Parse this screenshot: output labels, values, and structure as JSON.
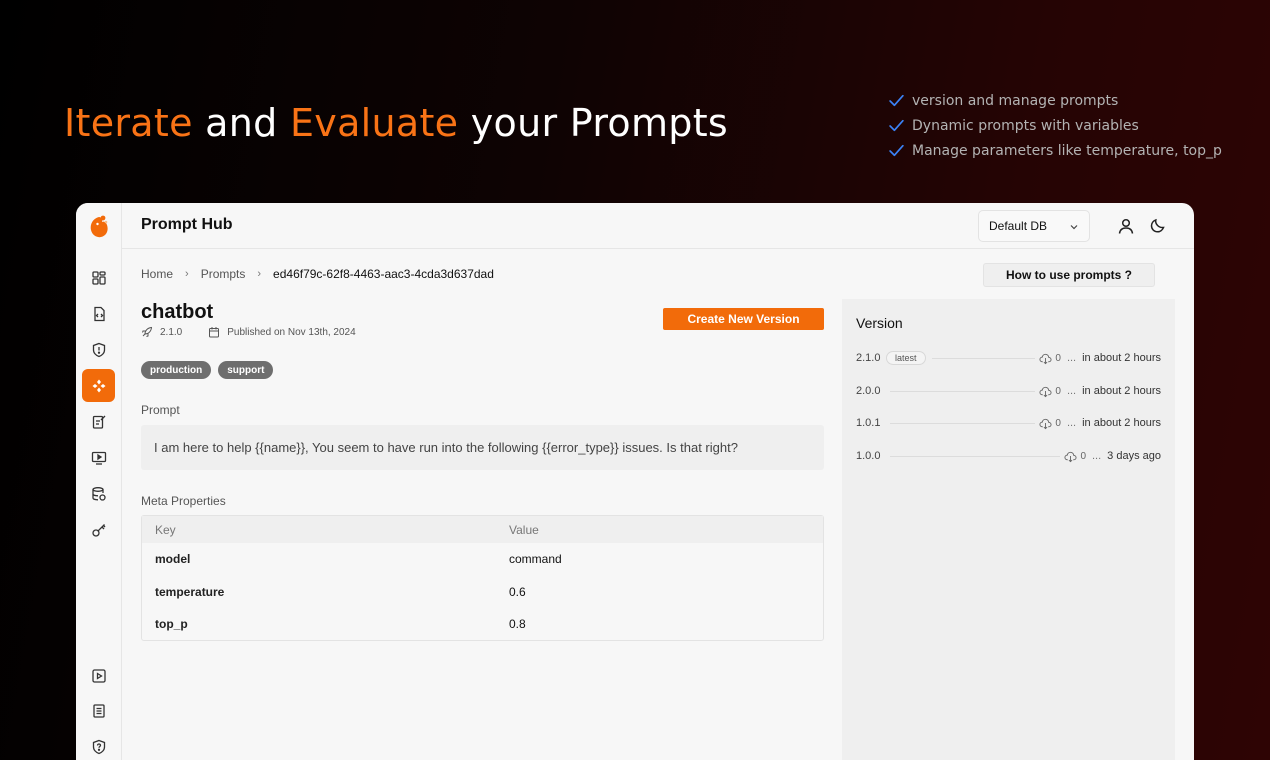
{
  "hero": {
    "word1": "Iterate",
    "word2": "and",
    "word3": "Evaluate",
    "word4": "your Prompts",
    "features": [
      "version and manage prompts",
      "Dynamic prompts with variables",
      "Manage parameters like temperature, top_p"
    ]
  },
  "app": {
    "title": "Prompt Hub",
    "db_select": "Default DB",
    "sidebar_icons": [
      "dashboard-icon",
      "file-code-icon",
      "shield-icon",
      "prompt-hub-icon",
      "edit-note-icon",
      "monitor-play-icon",
      "database-icon",
      "key-icon",
      "play-icon",
      "document-icon",
      "shield-question-icon"
    ],
    "breadcrumb": [
      "Home",
      "Prompts",
      "ed46f79c-62f8-4463-aac3-4cda3d637dad"
    ],
    "how_button": "How to use prompts ?",
    "prompt": {
      "name": "chatbot",
      "version": "2.1.0",
      "published": "Published on Nov 13th, 2024",
      "create_button": "Create New Version",
      "tags": [
        "production",
        "support"
      ],
      "prompt_label": "Prompt",
      "text": "I am here to help {{name}}, You seem to have run into the following {{error_type}} issues. Is that right?"
    },
    "meta": {
      "label": "Meta Properties",
      "columns": [
        "Key",
        "Value"
      ],
      "rows": [
        [
          "model",
          "command"
        ],
        [
          "temperature",
          "0.6"
        ],
        [
          "top_p",
          "0.8"
        ]
      ]
    },
    "versions": {
      "title": "Version",
      "items": [
        {
          "version": "2.1.0",
          "badge": "latest",
          "downloads": "0",
          "dots": "...",
          "time": "in about 2 hours"
        },
        {
          "version": "2.0.0",
          "badge": "",
          "downloads": "0",
          "dots": "...",
          "time": "in about 2 hours"
        },
        {
          "version": "1.0.1",
          "badge": "",
          "downloads": "0",
          "dots": "...",
          "time": "in about 2 hours"
        },
        {
          "version": "1.0.0",
          "badge": "",
          "downloads": "0",
          "dots": "...",
          "time": "3 days ago"
        }
      ]
    }
  },
  "colors": {
    "accent": "#f26b0a",
    "headline_accent": "#f97316"
  }
}
